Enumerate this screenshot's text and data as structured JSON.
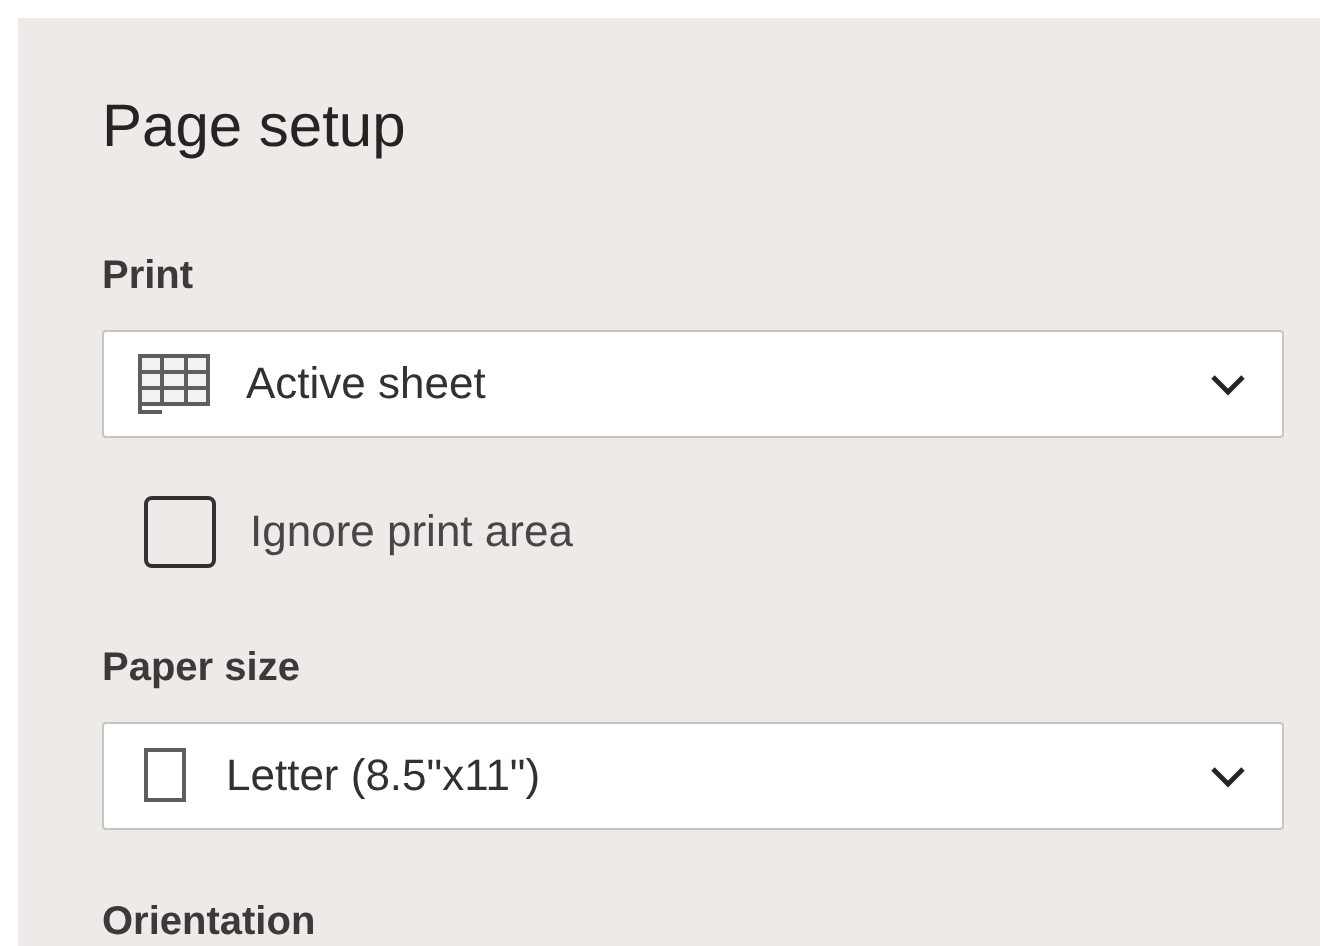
{
  "title": "Page setup",
  "sections": [
    {
      "label": "Print",
      "dropdown": {
        "kind": "sheet",
        "value": "Active sheet"
      },
      "checkbox": {
        "label": "Ignore print area",
        "checked": false
      }
    },
    {
      "label": "Paper size",
      "dropdown": {
        "kind": "page",
        "value": "Letter (8.5\"x11\")"
      }
    },
    {
      "label": "Orientation"
    }
  ]
}
